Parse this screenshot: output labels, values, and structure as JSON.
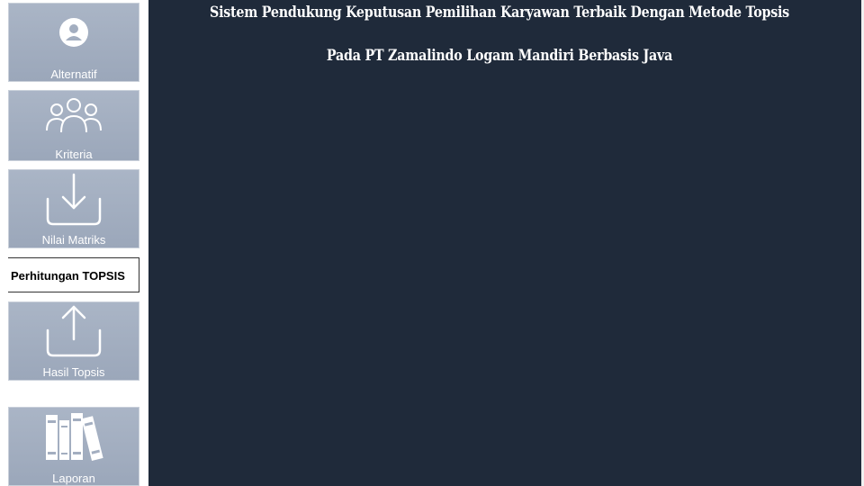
{
  "sidebar": {
    "items": [
      {
        "label": "Alternatif",
        "icon": "user-circle-icon"
      },
      {
        "label": "Kriteria",
        "icon": "users-group-icon"
      },
      {
        "label": "Nilai Matriks",
        "icon": "download-icon"
      },
      {
        "label": "Perhitungan TOPSIS",
        "icon": "",
        "active": true
      },
      {
        "label": "Hasil Topsis",
        "icon": "upload-icon"
      },
      {
        "label": "Laporan",
        "icon": "books-icon"
      }
    ]
  },
  "main": {
    "title_line1": "Sistem Pendukung Keputusan Pemilihan Karyawan Terbaik Dengan Metode Topsis",
    "title_line2": "Pada PT Zamalindo Logam Mandiri Berbasis Java"
  },
  "colors": {
    "main_background": "#1f2a3a",
    "tile_background": "#9ba7ba",
    "tile_text": "#ffffff",
    "active_text": "#000000"
  }
}
